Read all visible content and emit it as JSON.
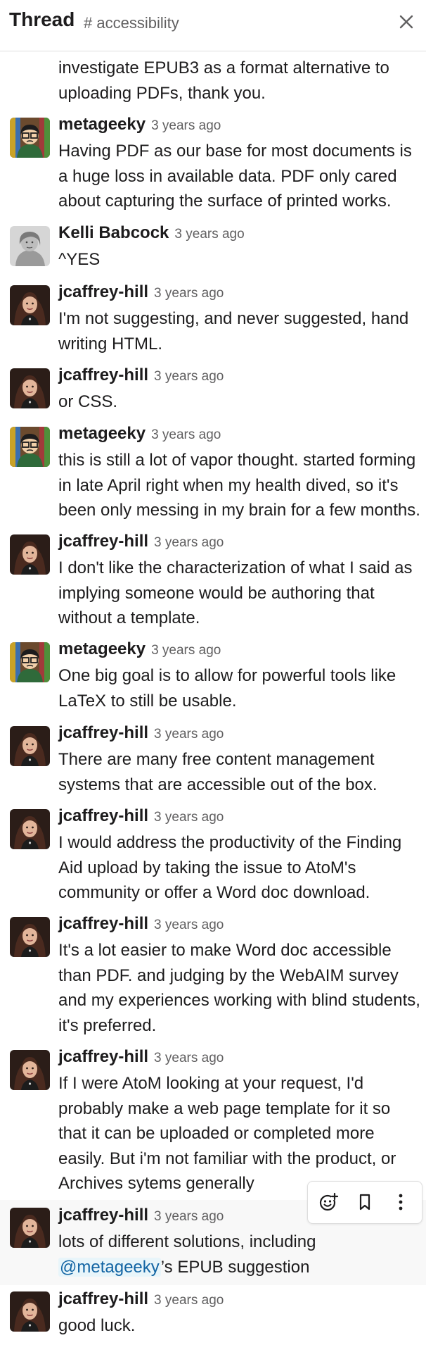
{
  "header": {
    "title": "Thread",
    "channel": "# accessibility",
    "close_icon": "close-icon"
  },
  "toolbar": {
    "icons": [
      "add-reaction-icon",
      "bookmark-icon",
      "more-actions-icon"
    ]
  },
  "continued_text": "investigate EPUB3 as a format alternative to uploading PDFs, thank you.",
  "messages": [
    {
      "author": "metageeky",
      "time": "3 years ago",
      "avatar": "metageeky",
      "text": "Having PDF as our base for most documents is a huge loss in available data. PDF only cared about capturing the surface of printed works."
    },
    {
      "author": "Kelli Babcock",
      "time": "3 years ago",
      "avatar": "kelli",
      "text": "^YES"
    },
    {
      "author": "jcaffrey-hill",
      "time": "3 years ago",
      "avatar": "jcaffrey",
      "text": "I'm not suggesting, and never suggested, hand writing HTML."
    },
    {
      "author": "jcaffrey-hill",
      "time": "3 years ago",
      "avatar": "jcaffrey",
      "text": "or CSS."
    },
    {
      "author": "metageeky",
      "time": "3 years ago",
      "avatar": "metageeky",
      "text": "this is still a lot of vapor thought. started forming in late April right when my health dived, so it's been only messing in my brain for a few months."
    },
    {
      "author": "jcaffrey-hill",
      "time": "3 years ago",
      "avatar": "jcaffrey",
      "text": "I don't like the characterization of what I said as implying someone would be authoring that without a template."
    },
    {
      "author": "metageeky",
      "time": "3 years ago",
      "avatar": "metageeky",
      "text": "One big goal is to allow for powerful tools like LaTeX to still be usable."
    },
    {
      "author": "jcaffrey-hill",
      "time": "3 years ago",
      "avatar": "jcaffrey",
      "text": "There are many free content management systems that are accessible out of the box."
    },
    {
      "author": "jcaffrey-hill",
      "time": "3 years ago",
      "avatar": "jcaffrey",
      "text": "I would address the productivity of the Finding Aid upload by taking the issue to AtoM's community or offer a Word doc download."
    },
    {
      "author": "jcaffrey-hill",
      "time": "3 years ago",
      "avatar": "jcaffrey",
      "text": "It's a lot easier to make Word doc accessible than PDF. and judging by the WebAIM survey and my experiences working with blind students, it's preferred."
    },
    {
      "author": "jcaffrey-hill",
      "time": "3 years ago",
      "avatar": "jcaffrey",
      "text": "If I were AtoM looking at your request, I'd probably make a web page template for it so that it can be uploaded or completed more easily. But i'm not familiar with the product, or Archives sytems generally"
    },
    {
      "author": "jcaffrey-hill",
      "time": "3 years ago",
      "avatar": "jcaffrey",
      "text_before": "lots of different solutions, including",
      "mention": "@metageeky",
      "text_after": "’s EPUB suggestion"
    },
    {
      "author": "jcaffrey-hill",
      "time": "3 years ago",
      "avatar": "jcaffrey",
      "text": "good luck."
    }
  ]
}
